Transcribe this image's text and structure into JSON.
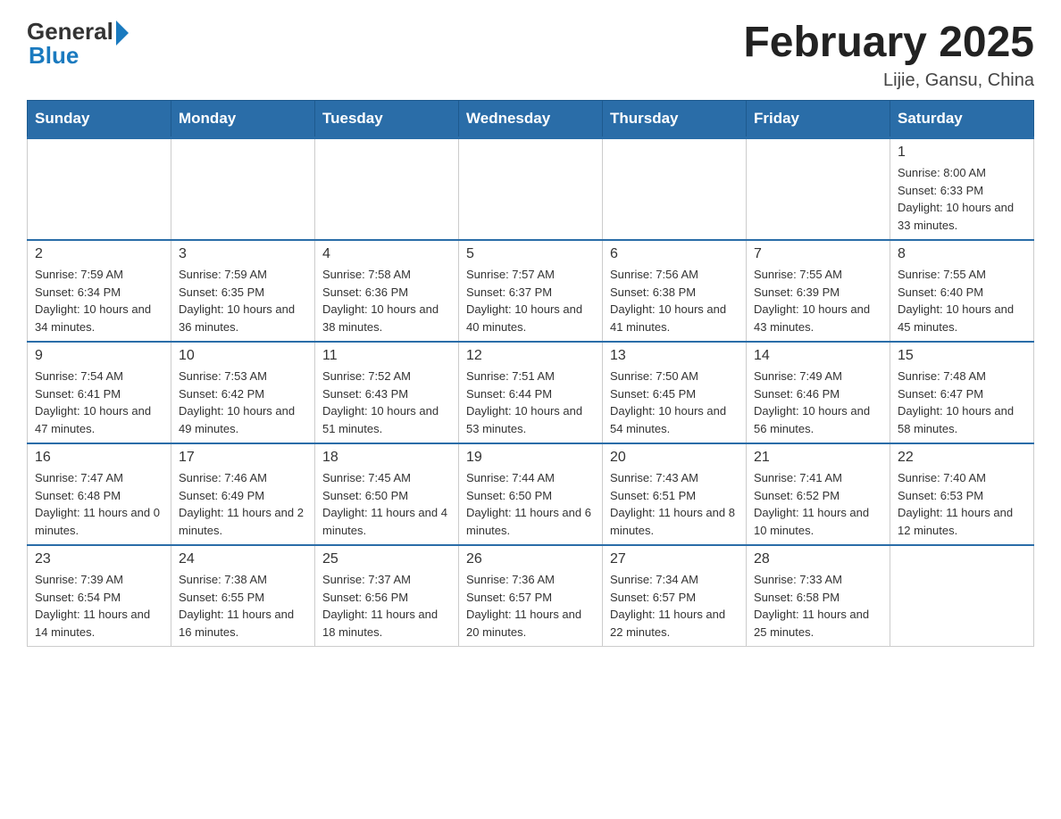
{
  "logo": {
    "general": "General",
    "blue": "Blue"
  },
  "header": {
    "title": "February 2025",
    "location": "Lijie, Gansu, China"
  },
  "days_of_week": [
    "Sunday",
    "Monday",
    "Tuesday",
    "Wednesday",
    "Thursday",
    "Friday",
    "Saturday"
  ],
  "weeks": [
    [
      {
        "day": "",
        "info": ""
      },
      {
        "day": "",
        "info": ""
      },
      {
        "day": "",
        "info": ""
      },
      {
        "day": "",
        "info": ""
      },
      {
        "day": "",
        "info": ""
      },
      {
        "day": "",
        "info": ""
      },
      {
        "day": "1",
        "info": "Sunrise: 8:00 AM\nSunset: 6:33 PM\nDaylight: 10 hours and 33 minutes."
      }
    ],
    [
      {
        "day": "2",
        "info": "Sunrise: 7:59 AM\nSunset: 6:34 PM\nDaylight: 10 hours and 34 minutes."
      },
      {
        "day": "3",
        "info": "Sunrise: 7:59 AM\nSunset: 6:35 PM\nDaylight: 10 hours and 36 minutes."
      },
      {
        "day": "4",
        "info": "Sunrise: 7:58 AM\nSunset: 6:36 PM\nDaylight: 10 hours and 38 minutes."
      },
      {
        "day": "5",
        "info": "Sunrise: 7:57 AM\nSunset: 6:37 PM\nDaylight: 10 hours and 40 minutes."
      },
      {
        "day": "6",
        "info": "Sunrise: 7:56 AM\nSunset: 6:38 PM\nDaylight: 10 hours and 41 minutes."
      },
      {
        "day": "7",
        "info": "Sunrise: 7:55 AM\nSunset: 6:39 PM\nDaylight: 10 hours and 43 minutes."
      },
      {
        "day": "8",
        "info": "Sunrise: 7:55 AM\nSunset: 6:40 PM\nDaylight: 10 hours and 45 minutes."
      }
    ],
    [
      {
        "day": "9",
        "info": "Sunrise: 7:54 AM\nSunset: 6:41 PM\nDaylight: 10 hours and 47 minutes."
      },
      {
        "day": "10",
        "info": "Sunrise: 7:53 AM\nSunset: 6:42 PM\nDaylight: 10 hours and 49 minutes."
      },
      {
        "day": "11",
        "info": "Sunrise: 7:52 AM\nSunset: 6:43 PM\nDaylight: 10 hours and 51 minutes."
      },
      {
        "day": "12",
        "info": "Sunrise: 7:51 AM\nSunset: 6:44 PM\nDaylight: 10 hours and 53 minutes."
      },
      {
        "day": "13",
        "info": "Sunrise: 7:50 AM\nSunset: 6:45 PM\nDaylight: 10 hours and 54 minutes."
      },
      {
        "day": "14",
        "info": "Sunrise: 7:49 AM\nSunset: 6:46 PM\nDaylight: 10 hours and 56 minutes."
      },
      {
        "day": "15",
        "info": "Sunrise: 7:48 AM\nSunset: 6:47 PM\nDaylight: 10 hours and 58 minutes."
      }
    ],
    [
      {
        "day": "16",
        "info": "Sunrise: 7:47 AM\nSunset: 6:48 PM\nDaylight: 11 hours and 0 minutes."
      },
      {
        "day": "17",
        "info": "Sunrise: 7:46 AM\nSunset: 6:49 PM\nDaylight: 11 hours and 2 minutes."
      },
      {
        "day": "18",
        "info": "Sunrise: 7:45 AM\nSunset: 6:50 PM\nDaylight: 11 hours and 4 minutes."
      },
      {
        "day": "19",
        "info": "Sunrise: 7:44 AM\nSunset: 6:50 PM\nDaylight: 11 hours and 6 minutes."
      },
      {
        "day": "20",
        "info": "Sunrise: 7:43 AM\nSunset: 6:51 PM\nDaylight: 11 hours and 8 minutes."
      },
      {
        "day": "21",
        "info": "Sunrise: 7:41 AM\nSunset: 6:52 PM\nDaylight: 11 hours and 10 minutes."
      },
      {
        "day": "22",
        "info": "Sunrise: 7:40 AM\nSunset: 6:53 PM\nDaylight: 11 hours and 12 minutes."
      }
    ],
    [
      {
        "day": "23",
        "info": "Sunrise: 7:39 AM\nSunset: 6:54 PM\nDaylight: 11 hours and 14 minutes."
      },
      {
        "day": "24",
        "info": "Sunrise: 7:38 AM\nSunset: 6:55 PM\nDaylight: 11 hours and 16 minutes."
      },
      {
        "day": "25",
        "info": "Sunrise: 7:37 AM\nSunset: 6:56 PM\nDaylight: 11 hours and 18 minutes."
      },
      {
        "day": "26",
        "info": "Sunrise: 7:36 AM\nSunset: 6:57 PM\nDaylight: 11 hours and 20 minutes."
      },
      {
        "day": "27",
        "info": "Sunrise: 7:34 AM\nSunset: 6:57 PM\nDaylight: 11 hours and 22 minutes."
      },
      {
        "day": "28",
        "info": "Sunrise: 7:33 AM\nSunset: 6:58 PM\nDaylight: 11 hours and 25 minutes."
      },
      {
        "day": "",
        "info": ""
      }
    ]
  ]
}
